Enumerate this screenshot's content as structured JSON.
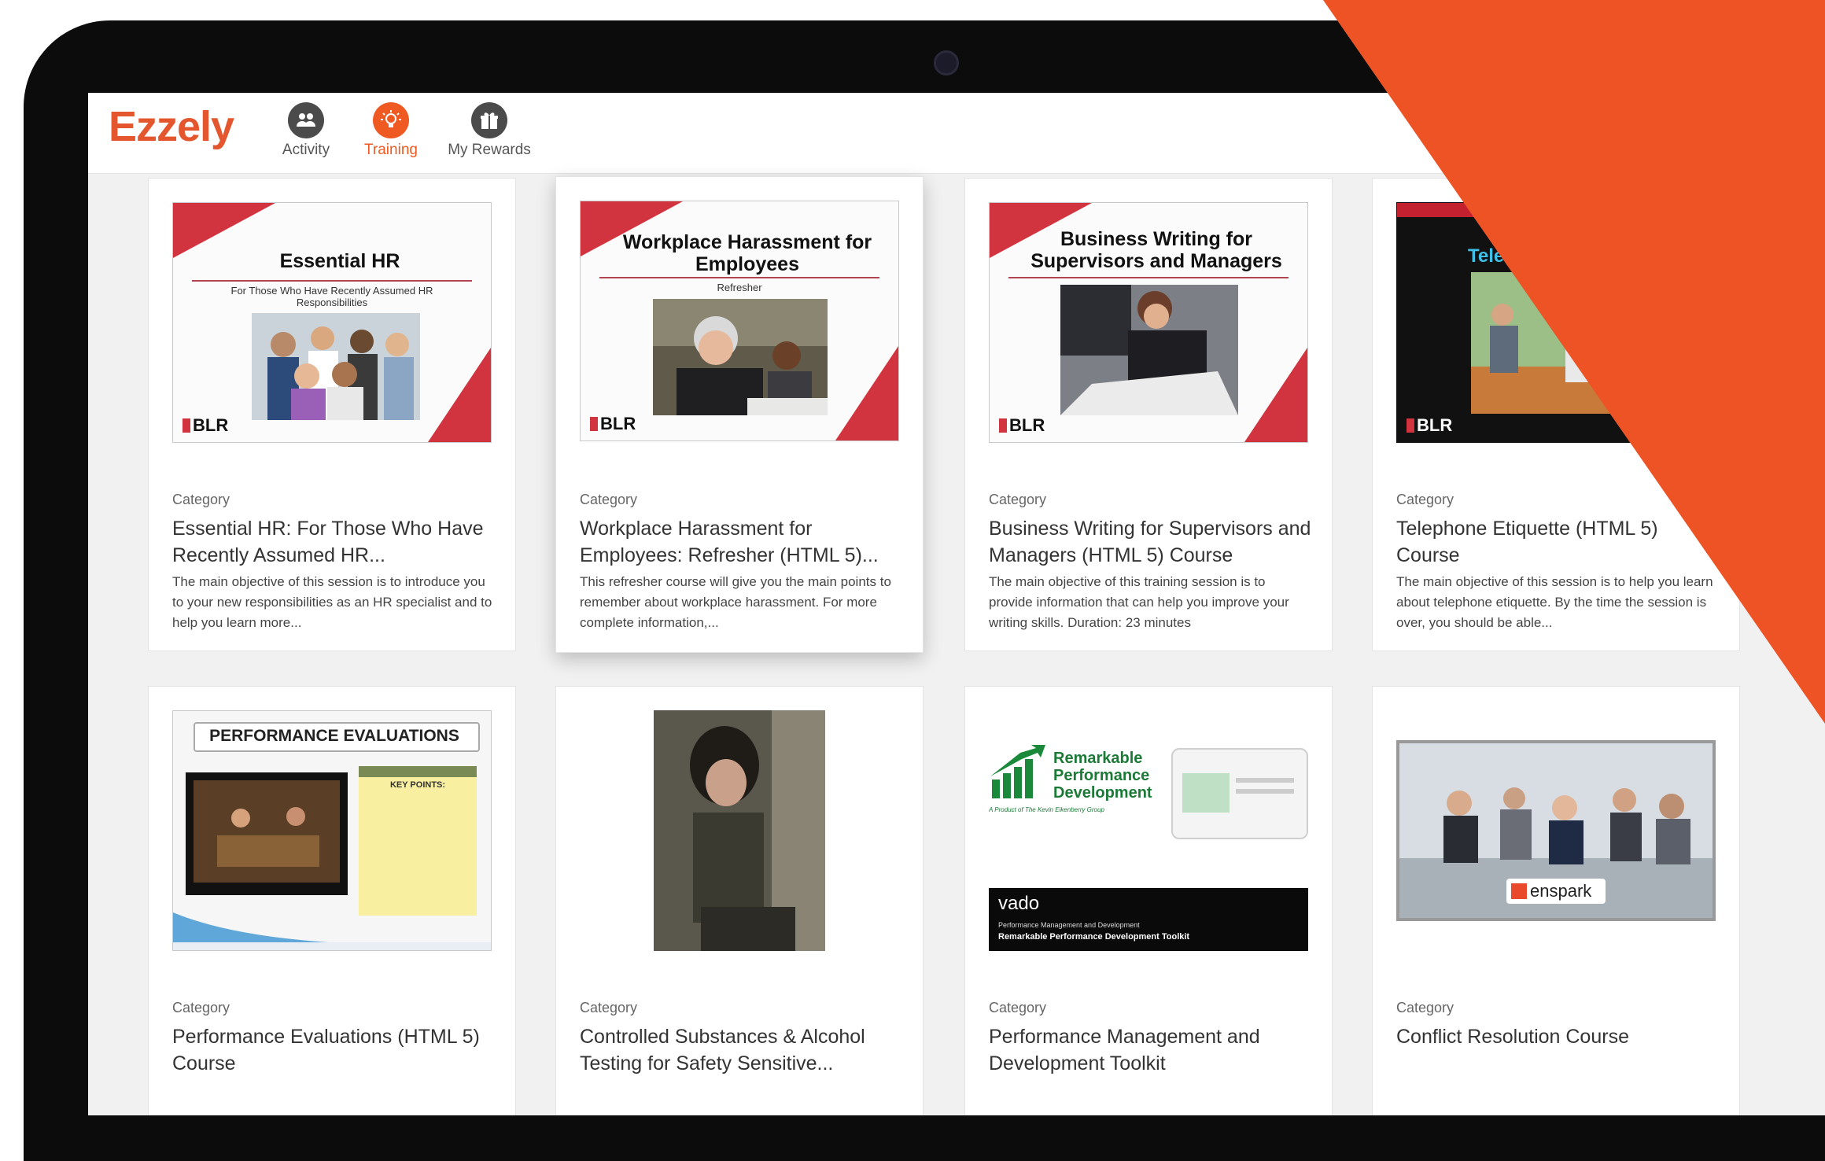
{
  "app": {
    "logo": "Ezzely",
    "nav": [
      {
        "label": "Activity",
        "icon": "people-icon",
        "active": false
      },
      {
        "label": "Training",
        "icon": "lightbulb-icon",
        "active": true
      },
      {
        "label": "My Rewards",
        "icon": "gift-icon",
        "active": false
      }
    ]
  },
  "colors": {
    "accent": "#ef5a22",
    "overlay": "#ee5325",
    "slide_red": "#d2343f"
  },
  "cards": [
    {
      "thumb": {
        "title": "Essential HR",
        "subtitle": "For Those Who Have Recently Assumed HR Responsibilities",
        "brand": "BLR"
      },
      "category": "Category",
      "title": "Essential HR: For Those Who Have Recently Assumed HR...",
      "description": "The main objective of this session is to introduce you to your new responsibilities as an HR specialist and to help you learn more..."
    },
    {
      "thumb": {
        "title": "Workplace Harassment for Employees",
        "subtitle": "Refresher",
        "brand": "BLR"
      },
      "category": "Category",
      "title": "Workplace Harassment for Employees: Refresher (HTML 5)...",
      "description": "This refresher course will give you the main points to remember about workplace harassment. For more complete information,..."
    },
    {
      "thumb": {
        "title": "Business Writing for Supervisors and Managers",
        "brand": "BLR"
      },
      "category": "Category",
      "title": "Business Writing for Supervisors and Managers (HTML 5) Course",
      "description": "The main objective of this training session is to provide information that can help you improve your writing skills. Duration: 23 minutes"
    },
    {
      "thumb": {
        "title": "Tele",
        "brand": "BLR"
      },
      "category": "Category",
      "title": "Telephone Etiquette (HTML 5) Course",
      "description": "The main objective of this session is to help you learn about telephone etiquette. By the time the session is over, you should be able..."
    },
    {
      "thumb": {
        "title": "PERFORMANCE EVALUATIONS",
        "note": "KEY POINTS:"
      },
      "category": "Category",
      "title": "Performance Evaluations (HTML 5) Course"
    },
    {
      "thumb": {},
      "category": "Category",
      "title": "Controlled Substances & Alcohol Testing for Safety Sensitive..."
    },
    {
      "thumb": {
        "title": "Remarkable Performance Development",
        "tagline": "A Product of The Kevin Eikenberry Group",
        "brand": "vado",
        "brand_sub": "Performance Management and Development",
        "brand_title": "Remarkable Performance Development Toolkit"
      },
      "category": "Category",
      "title": "Performance Management and Development Toolkit"
    },
    {
      "thumb": {
        "brand": "enspark"
      },
      "category": "Category",
      "title": "Conflict Resolution Course"
    }
  ]
}
